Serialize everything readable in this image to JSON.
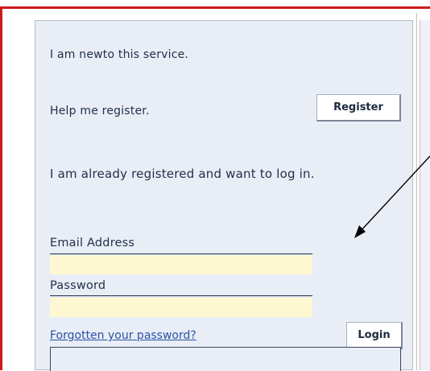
{
  "new_user": {
    "intro": "I am newto this service.",
    "help_text": "Help me register.",
    "register_label": "Register"
  },
  "login": {
    "intro": "I am already registered and want to log in.",
    "email_label": "Email Address",
    "email_value": "",
    "password_label": "Password",
    "password_value": "",
    "forgot_link": "Forgotten your password?",
    "login_label": "Login"
  },
  "colors": {
    "frame_border": "#cc1a1a",
    "panel_background": "#e9edf5",
    "field_background": "#fdf7d2",
    "link": "#2952a6",
    "text": "#1f2f4a"
  },
  "icons": [
    "pointer-arrow"
  ]
}
